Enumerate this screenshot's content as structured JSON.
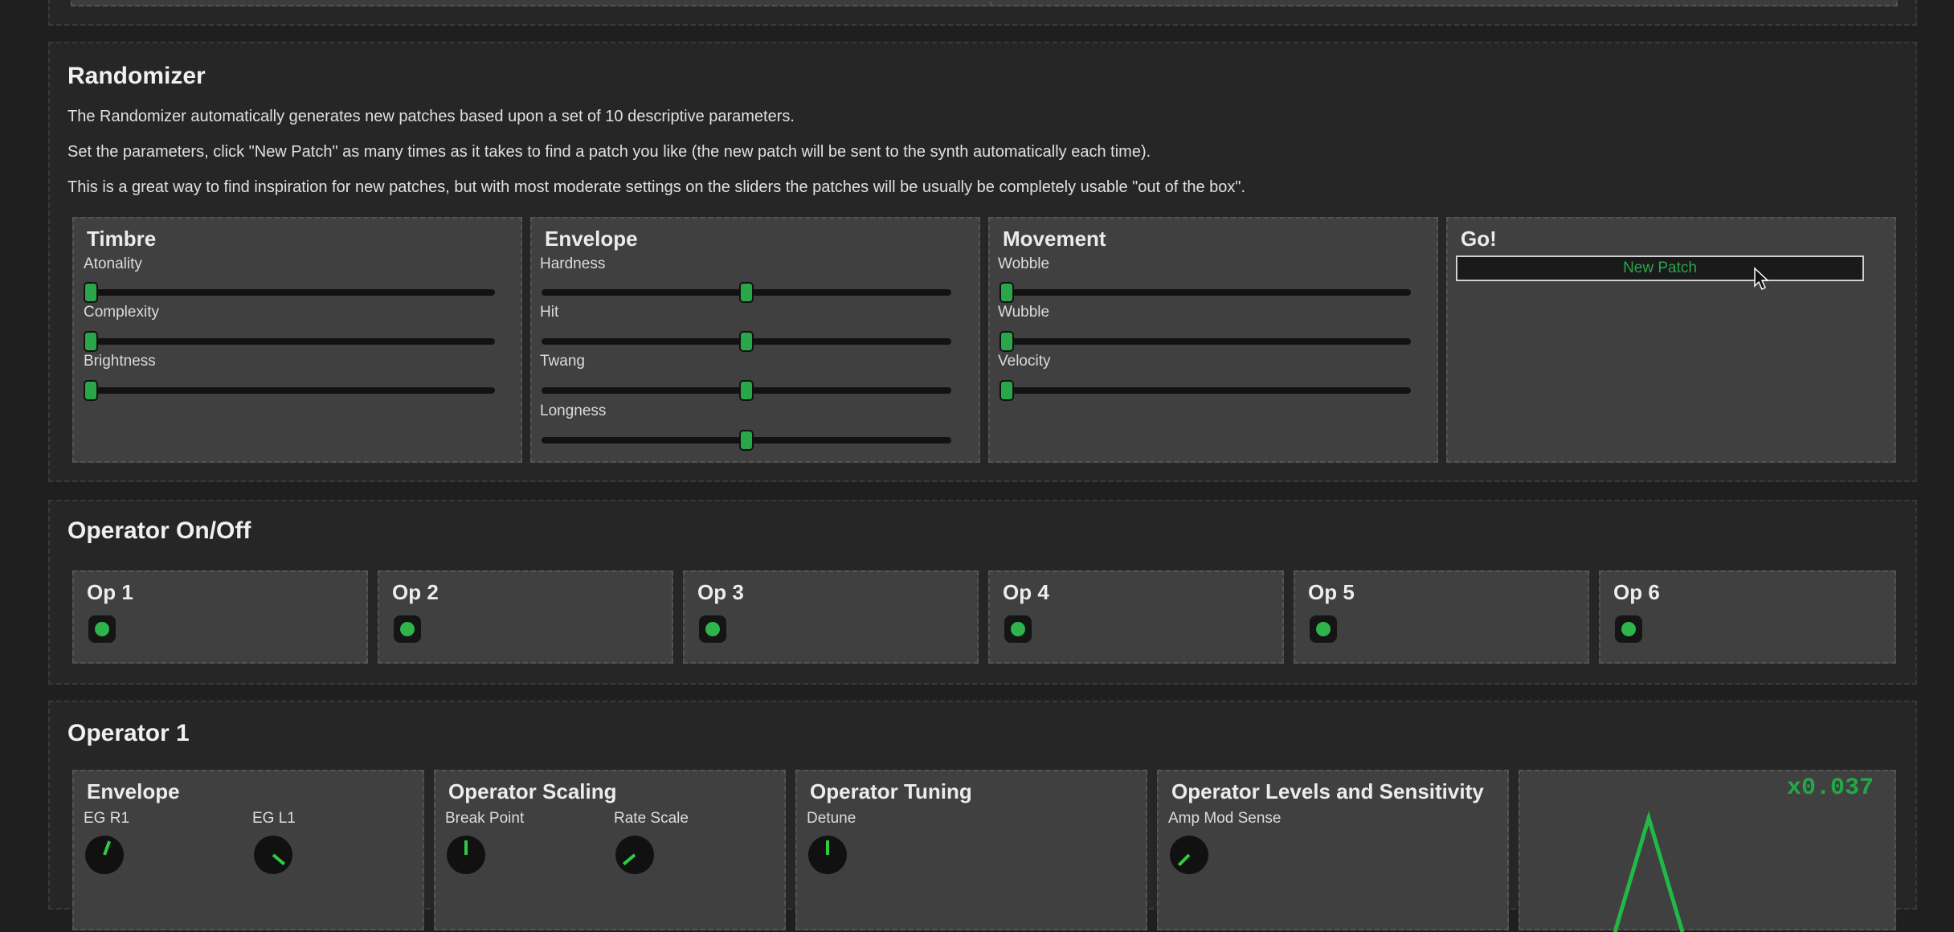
{
  "randomizer": {
    "title": "Randomizer",
    "desc1": "The Randomizer automatically generates new patches based upon a set of 10 descriptive parameters.",
    "desc2": "Set the parameters, click \"New Patch\" as many times as it takes to find a patch you like (the new patch will be sent to the synth automatically each time).",
    "desc3": "This is a great way to find inspiration for new patches, but with most moderate settings on the sliders the patches will be usually be completely usable \"out of the box\".",
    "timbre": {
      "title": "Timbre",
      "atonality": "Atonality",
      "complexity": "Complexity",
      "brightness": "Brightness"
    },
    "envelope": {
      "title": "Envelope",
      "hardness": "Hardness",
      "hit": "Hit",
      "twang": "Twang",
      "longness": "Longness"
    },
    "movement": {
      "title": "Movement",
      "wobble": "Wobble",
      "wubble": "Wubble",
      "velocity": "Velocity"
    },
    "go": {
      "title": "Go!",
      "new_patch": "New Patch"
    },
    "slider_values": {
      "atonality": 0,
      "complexity": 0,
      "brightness": 0,
      "hardness": 0.5,
      "hit": 0.5,
      "twang": 0.5,
      "longness": 0.5,
      "wobble": 0,
      "wubble": 0,
      "velocity": 0
    }
  },
  "operator_onoff": {
    "title": "Operator On/Off",
    "ops": [
      "Op 1",
      "Op 2",
      "Op 3",
      "Op 4",
      "Op 5",
      "Op 6"
    ]
  },
  "operator1": {
    "title": "Operator 1",
    "envelope": {
      "title": "Envelope",
      "eg_r1": "EG R1",
      "eg_l1": "EG L1"
    },
    "scaling": {
      "title": "Operator Scaling",
      "break_point": "Break Point",
      "rate_scale": "Rate Scale"
    },
    "tuning": {
      "title": "Operator Tuning",
      "detune": "Detune"
    },
    "levels": {
      "title": "Operator Levels and Sensitivity",
      "amp_mod_sense": "Amp Mod Sense"
    },
    "ratio": "x0.037"
  },
  "colors": {
    "accent": "#2aa64a",
    "panel": "#404040",
    "background": "#1f1f1f"
  }
}
